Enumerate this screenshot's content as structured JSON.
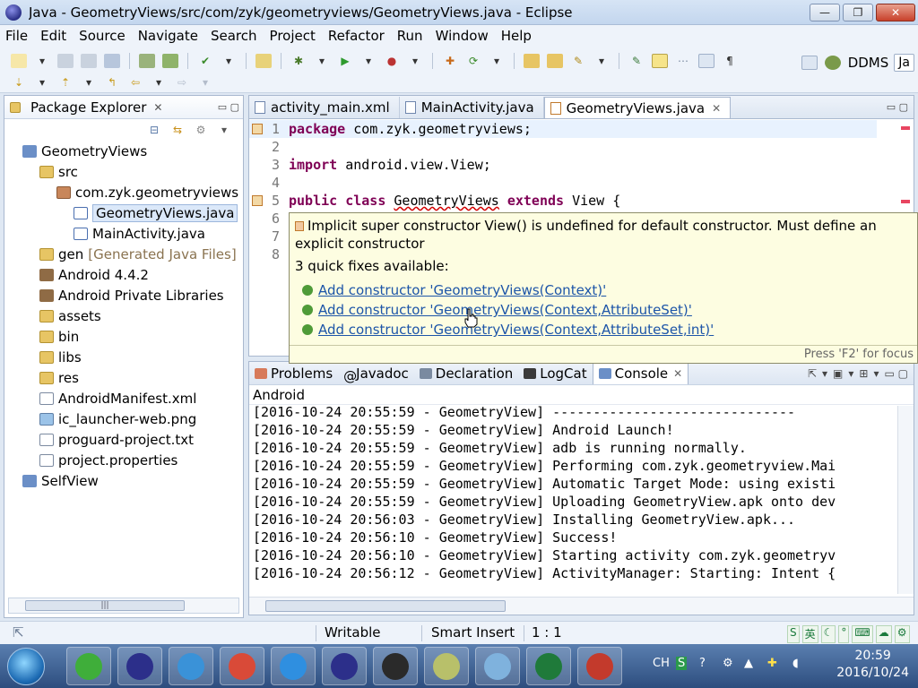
{
  "window": {
    "title": "Java - GeometryViews/src/com/zyk/geometryviews/GeometryViews.java - Eclipse",
    "minimize": "—",
    "maximize": "❐",
    "close": "✕"
  },
  "menu": [
    "File",
    "Edit",
    "Source",
    "Navigate",
    "Search",
    "Project",
    "Refactor",
    "Run",
    "Window",
    "Help"
  ],
  "perspective": {
    "ddms_label": "DDMS",
    "java_label": "Ja"
  },
  "package_explorer": {
    "title": "Package Explorer",
    "tree": [
      {
        "label": "GeometryViews",
        "icon": "project",
        "indent": 0
      },
      {
        "label": "src",
        "icon": "folder",
        "indent": 1
      },
      {
        "label": "com.zyk.geometryviews",
        "icon": "pkgicon",
        "indent": 2
      },
      {
        "label": "GeometryViews.java",
        "icon": "java",
        "indent": 3,
        "selected": true
      },
      {
        "label": "MainActivity.java",
        "icon": "java",
        "indent": 3
      },
      {
        "label": "gen",
        "icon": "folder",
        "indent": 1,
        "note": "[Generated Java Files]"
      },
      {
        "label": "Android 4.4.2",
        "icon": "lib",
        "indent": 1
      },
      {
        "label": "Android Private Libraries",
        "icon": "lib",
        "indent": 1
      },
      {
        "label": "assets",
        "icon": "folder",
        "indent": 1
      },
      {
        "label": "bin",
        "icon": "folder",
        "indent": 1
      },
      {
        "label": "libs",
        "icon": "folder",
        "indent": 1
      },
      {
        "label": "res",
        "icon": "folder",
        "indent": 1
      },
      {
        "label": "AndroidManifest.xml",
        "icon": "file",
        "indent": 1
      },
      {
        "label": "ic_launcher-web.png",
        "icon": "img",
        "indent": 1
      },
      {
        "label": "proguard-project.txt",
        "icon": "file",
        "indent": 1
      },
      {
        "label": "project.properties",
        "icon": "file",
        "indent": 1
      },
      {
        "label": "SelfView",
        "icon": "project",
        "indent": 0
      }
    ]
  },
  "editor": {
    "tabs": [
      {
        "label": "activity_main.xml",
        "active": false
      },
      {
        "label": "MainActivity.java",
        "active": false
      },
      {
        "label": "GeometryViews.java",
        "active": true
      }
    ],
    "lines": [
      {
        "n": "1",
        "parts": [
          {
            "t": "package",
            "k": "kw"
          },
          {
            "t": " com.zyk.geometryviews;",
            "k": ""
          }
        ]
      },
      {
        "n": "2",
        "parts": []
      },
      {
        "n": "3",
        "parts": [
          {
            "t": "import",
            "k": "kw"
          },
          {
            "t": " android.view.View;",
            "k": ""
          }
        ]
      },
      {
        "n": "4",
        "parts": []
      },
      {
        "n": "5",
        "parts": [
          {
            "t": "public",
            "k": "kw"
          },
          {
            "t": " ",
            "k": ""
          },
          {
            "t": "class",
            "k": "kw"
          },
          {
            "t": " ",
            "k": ""
          },
          {
            "t": "GeometryViews",
            "k": "err"
          },
          {
            "t": " ",
            "k": ""
          },
          {
            "t": "extends",
            "k": "kw"
          },
          {
            "t": " View {",
            "k": ""
          }
        ]
      },
      {
        "n": "6",
        "parts": []
      },
      {
        "n": "7",
        "parts": []
      },
      {
        "n": "8",
        "parts": []
      }
    ]
  },
  "popup": {
    "message": "Implicit super constructor View() is undefined for default constructor. Must define an explicit constructor",
    "count": "3 quick fixes available:",
    "fixes": [
      "Add constructor 'GeometryViews(Context)'",
      "Add constructor 'GeometryViews(Context,AttributeSet)'",
      "Add constructor 'GeometryViews(Context,AttributeSet,int)'"
    ],
    "footer": "Press 'F2' for focus"
  },
  "console": {
    "tabs": [
      {
        "label": "Problems",
        "active": false
      },
      {
        "label": "Javadoc",
        "active": false
      },
      {
        "label": "Declaration",
        "active": false
      },
      {
        "label": "LogCat",
        "active": false
      },
      {
        "label": "Console",
        "active": true
      }
    ],
    "sublabel": "Android",
    "lines": [
      "[2016-10-24 20:55:59 - GeometryView] ------------------------------",
      "[2016-10-24 20:55:59 - GeometryView] Android Launch!",
      "[2016-10-24 20:55:59 - GeometryView] adb is running normally.",
      "[2016-10-24 20:55:59 - GeometryView] Performing com.zyk.geometryview.Mai",
      "[2016-10-24 20:55:59 - GeometryView] Automatic Target Mode: using existi",
      "[2016-10-24 20:55:59 - GeometryView] Uploading GeometryView.apk onto dev",
      "[2016-10-24 20:56:03 - GeometryView] Installing GeometryView.apk...",
      "[2016-10-24 20:56:10 - GeometryView] Success!",
      "[2016-10-24 20:56:10 - GeometryView] Starting activity com.zyk.geometryv",
      "[2016-10-24 20:56:12 - GeometryView] ActivityManager: Starting: Intent {"
    ]
  },
  "status": {
    "writable": "Writable",
    "insert_mode": "Smart Insert",
    "position": "1 : 1"
  },
  "ime": [
    "S",
    "英",
    "☾",
    "°",
    "⌨",
    "☁",
    "⚙"
  ],
  "tray": {
    "lang": "CH",
    "time": "20:59",
    "date": "2016/10/24"
  },
  "taskbar_apps": [
    {
      "name": "ie-icon",
      "color": "#3fae3a"
    },
    {
      "name": "eclipse-icon",
      "color": "#2c2f8a"
    },
    {
      "name": "network-icon",
      "color": "#3a92d8"
    },
    {
      "name": "chrome-icon",
      "color": "#d94a38"
    },
    {
      "name": "cloud-icon",
      "color": "#2f8fe0"
    },
    {
      "name": "eclipse-icon",
      "color": "#2c2f8a"
    },
    {
      "name": "android-sdk-icon",
      "color": "#2a2a2a"
    },
    {
      "name": "notes-icon",
      "color": "#b8c06a"
    },
    {
      "name": "notepad-icon",
      "color": "#7fb2dd"
    },
    {
      "name": "excel-icon",
      "color": "#1f7a3a"
    },
    {
      "name": "recorder-icon",
      "color": "#c33a2c"
    }
  ]
}
